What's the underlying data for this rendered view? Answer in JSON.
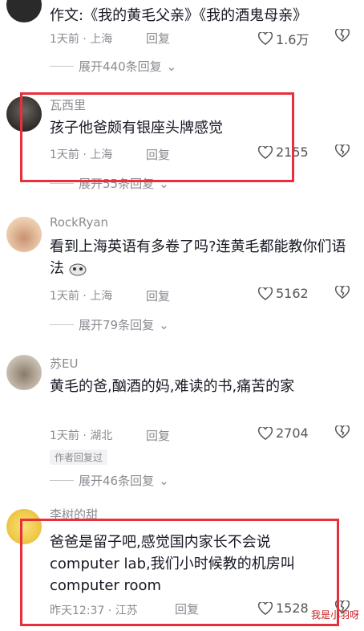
{
  "comments": [
    {
      "username": "",
      "text": "作文:《我的黄毛父亲》《我的酒鬼母亲》",
      "time": "1天前",
      "location": "上海",
      "reply": "回复",
      "likes": "1.6万",
      "expand": "展开440条回复"
    },
    {
      "username": "瓦西里",
      "text": "孩子他爸颇有银座头牌感觉",
      "time": "1天前",
      "location": "上海",
      "reply": "回复",
      "likes": "2155",
      "expand": "展开55条回复"
    },
    {
      "username": "RockRyan",
      "text": "看到上海英语有多卷了吗?连黄毛都能教你们语法",
      "time": "1天前",
      "location": "上海",
      "reply": "回复",
      "likes": "5162",
      "expand": "展开79条回复"
    },
    {
      "username": "苏EU",
      "text": "黄毛的爸,酗酒的妈,难读的书,痛苦的家",
      "time": "1天前",
      "location": "湖北",
      "reply": "回复",
      "likes": "2704",
      "author_tag": "作者回复过",
      "expand": "展开46条回复"
    },
    {
      "username": "李树的甜",
      "text": "爸爸是留子吧,感觉国内家长不会说computer lab,我们小时候教的机房叫computer room",
      "time": "昨天12:37",
      "location": "江苏",
      "reply": "回复",
      "likes": "1528"
    }
  ],
  "watermark": "我是小羽呀",
  "colors": {
    "highlight": "#e8303a",
    "meta": "#8a8b91",
    "text": "#161823"
  }
}
